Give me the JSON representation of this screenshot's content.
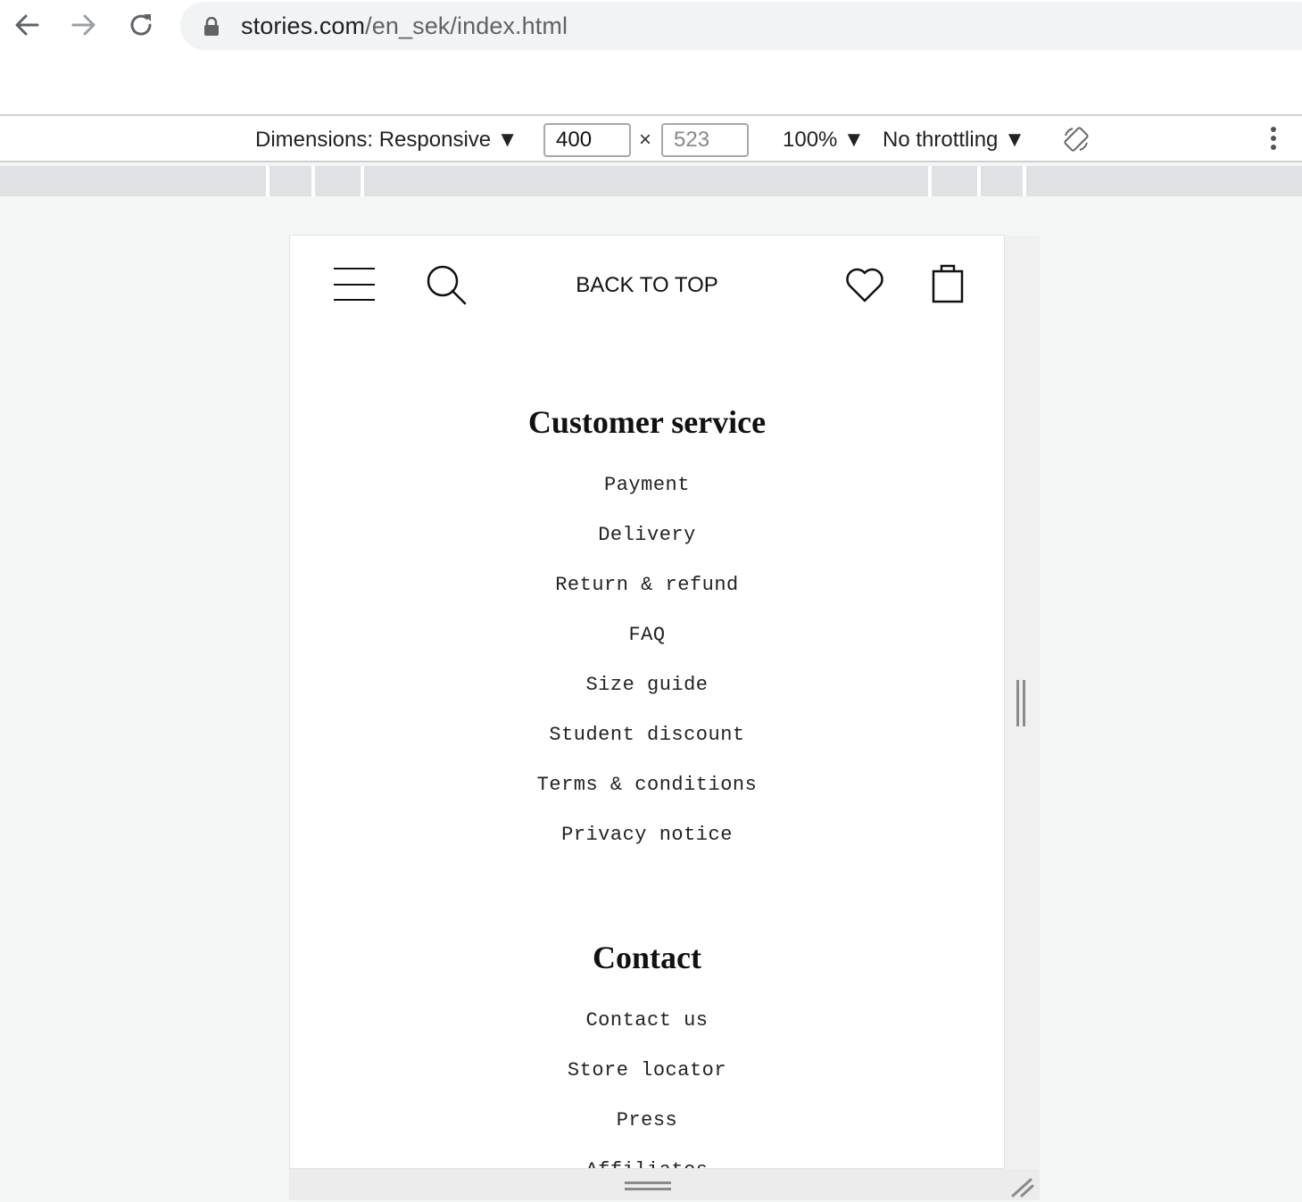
{
  "browser": {
    "url_host": "stories.com",
    "url_path": "/en_sek/index.html",
    "icons": [
      "back-arrow-icon",
      "forward-arrow-icon",
      "reload-icon",
      "lock-icon"
    ]
  },
  "device_toolbar": {
    "dimensions_label": "Dimensions: Responsive ▼",
    "width_value": "400",
    "height_placeholder": "523",
    "times": "×",
    "zoom_label": "100% ▼",
    "throttle_label": "No throttling ▼"
  },
  "site": {
    "header": {
      "back_to_top": "BACK TO TOP",
      "icons": [
        "menu-icon",
        "search-icon",
        "wishlist-heart-icon",
        "shopping-bag-icon"
      ]
    },
    "customer_service": {
      "title": "Customer service",
      "links": [
        "Payment",
        "Delivery",
        "Return & refund",
        "FAQ",
        "Size guide",
        "Student discount",
        "Terms & conditions",
        "Privacy notice"
      ]
    },
    "contact": {
      "title": "Contact",
      "links": [
        "Contact us",
        "Store locator",
        "Press",
        "Affiliates"
      ]
    }
  }
}
